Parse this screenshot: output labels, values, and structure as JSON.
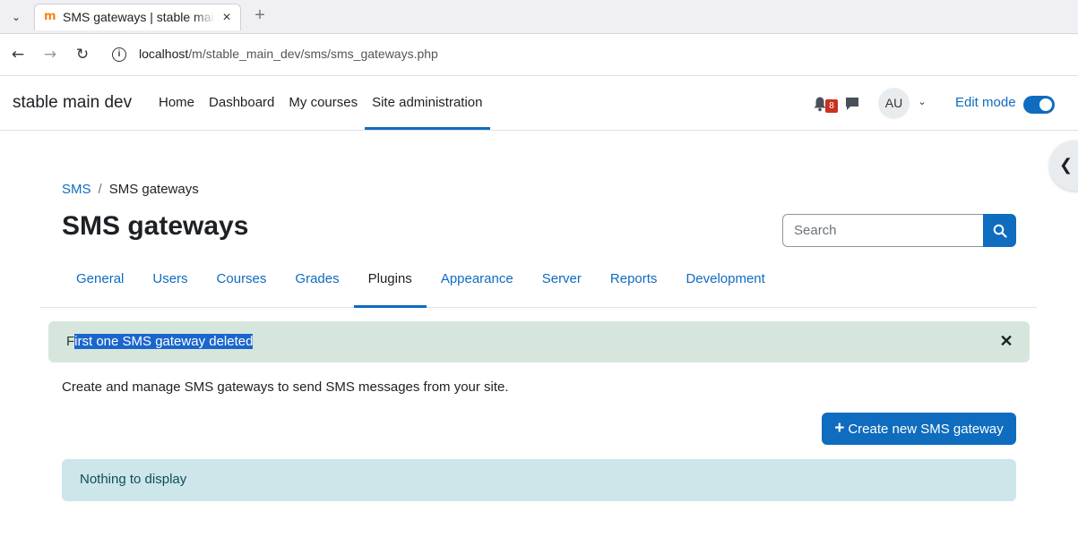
{
  "browser": {
    "tab_title": "SMS gateways | stable main dev",
    "url_host": "localhost",
    "url_path": "/m/stable_main_dev/sms/sms_gateways.php"
  },
  "header": {
    "site_name": "stable main dev",
    "nav": [
      "Home",
      "Dashboard",
      "My courses",
      "Site administration"
    ],
    "notification_count": "8",
    "avatar_initials": "AU",
    "edit_mode_label": "Edit mode",
    "edit_mode_on": true
  },
  "breadcrumb": {
    "link": "SMS",
    "separator": "/",
    "current": "SMS gateways"
  },
  "page": {
    "title": "SMS gateways",
    "search_placeholder": "Search"
  },
  "secondary_nav": [
    "General",
    "Users",
    "Courses",
    "Grades",
    "Plugins",
    "Appearance",
    "Server",
    "Reports",
    "Development"
  ],
  "alert": {
    "first_char": "F",
    "selected_text": "irst one SMS gateway deleted"
  },
  "description": "Create and manage SMS gateways to send SMS messages from your site.",
  "create_button": "Create new SMS gateway",
  "empty_message": "Nothing to display",
  "colors": {
    "primary": "#0f6cbf",
    "alert_success_bg": "#d7e6dc",
    "info_bg": "#cce6ea"
  }
}
